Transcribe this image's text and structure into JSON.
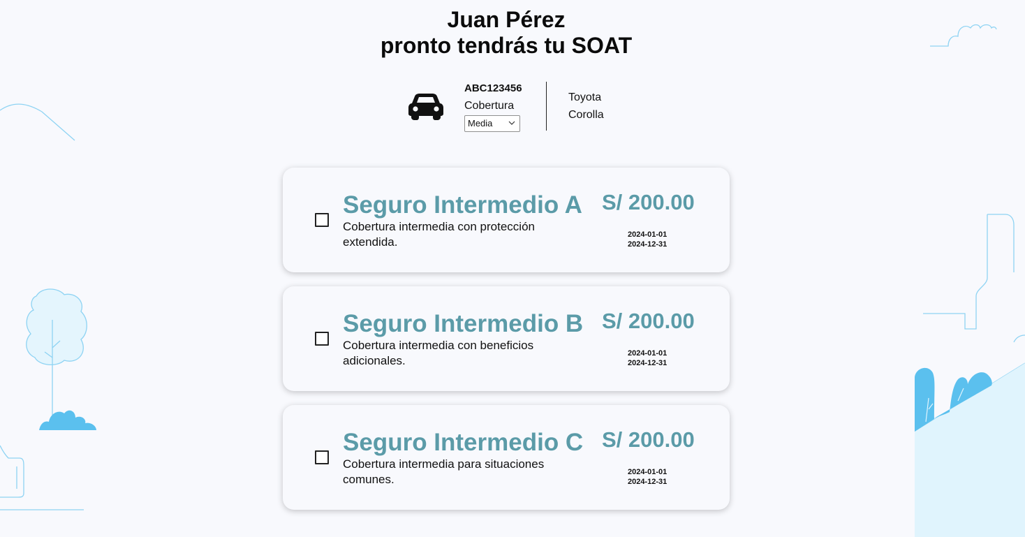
{
  "header": {
    "title_line1": "Juan Pérez",
    "title_line2": "pronto tendrás tu SOAT"
  },
  "vehicle": {
    "icon": "car-icon",
    "plate": "ABC123456",
    "coverage_label": "Cobertura",
    "coverage_selected": "Media",
    "brand": "Toyota",
    "model": "Corolla"
  },
  "plans": [
    {
      "name": "Seguro Intermedio A",
      "description": "Cobertura intermedia con protección extendida.",
      "price": "S/ 200.00",
      "start_date": "2024-01-01",
      "end_date": "2024-12-31",
      "checked": false
    },
    {
      "name": "Seguro Intermedio B",
      "description": "Cobertura intermedia con beneficios adicionales.",
      "price": "S/ 200.00",
      "start_date": "2024-01-01",
      "end_date": "2024-12-31",
      "checked": false
    },
    {
      "name": "Seguro Intermedio C",
      "description": "Cobertura intermedia para situaciones comunes.",
      "price": "S/ 200.00",
      "start_date": "2024-01-01",
      "end_date": "2024-12-31",
      "checked": false
    }
  ],
  "colors": {
    "accent": "#5b9ba8",
    "background": "#f8f9fd",
    "illustration": "#5bc0ee",
    "illustration_light": "#e0f4fd"
  }
}
